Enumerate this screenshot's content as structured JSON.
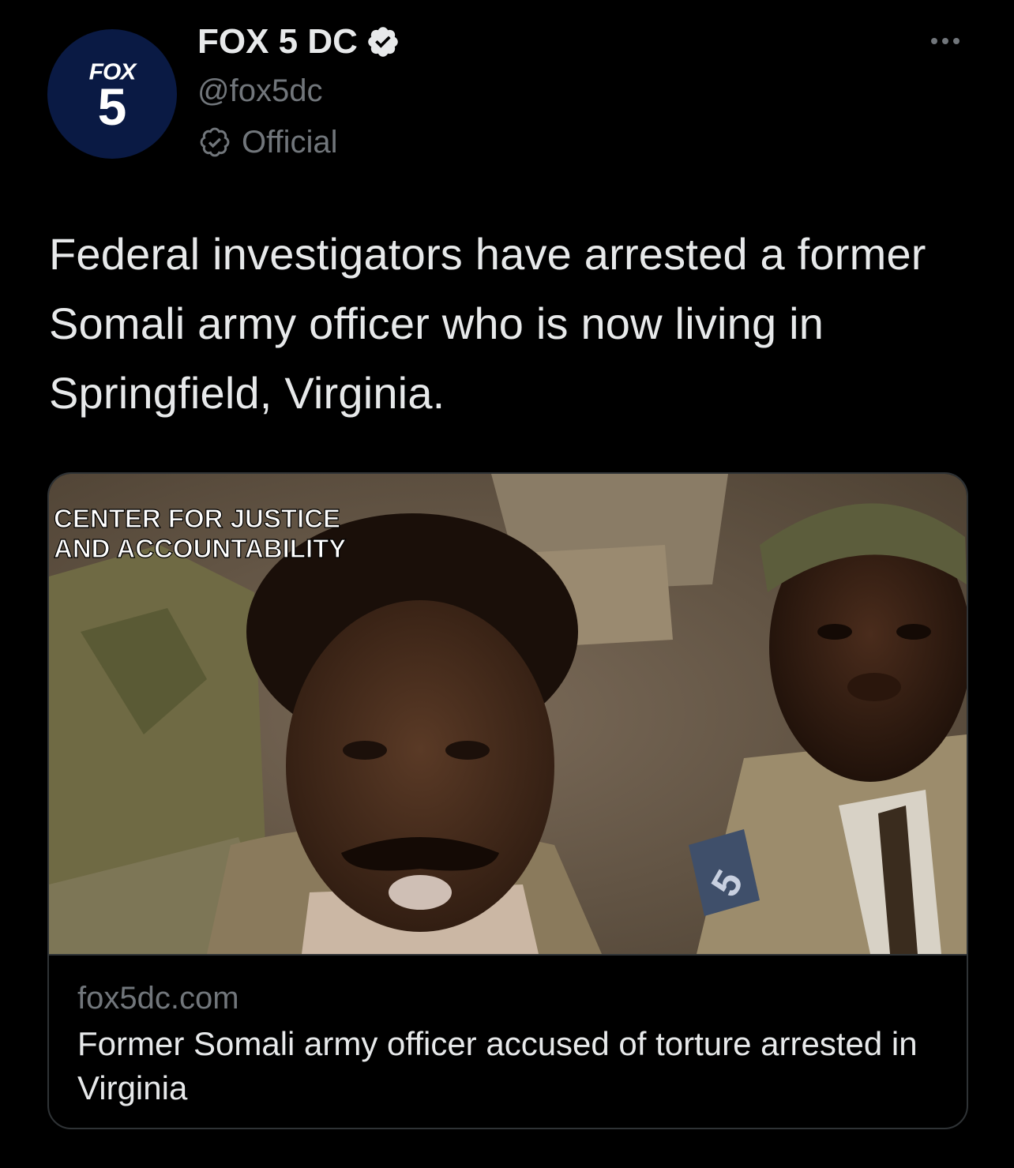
{
  "account": {
    "avatar_brand": "FOX",
    "avatar_number": "5",
    "display_name": "FOX 5 DC",
    "handle": "@fox5dc",
    "label": "Official"
  },
  "tweet": {
    "text": "Federal investigators have arrested a former Somali army officer who is now living in Springfield, Virginia."
  },
  "card": {
    "image_caption_line1": "CENTER FOR JUSTICE",
    "image_caption_line2": "AND ACCOUNTABILITY",
    "image_badge_number": "5",
    "domain": "fox5dc.com",
    "title": "Former Somali army officer accused of torture arrested in Virginia"
  },
  "icons": {
    "verified": "verified-badge-icon",
    "official": "official-badge-icon",
    "more": "more-options-icon"
  },
  "colors": {
    "background": "#000000",
    "primary_text": "#e7e9ea",
    "secondary_text": "#71767b",
    "border": "#2f3336",
    "avatar_bg": "#0a1a44"
  }
}
